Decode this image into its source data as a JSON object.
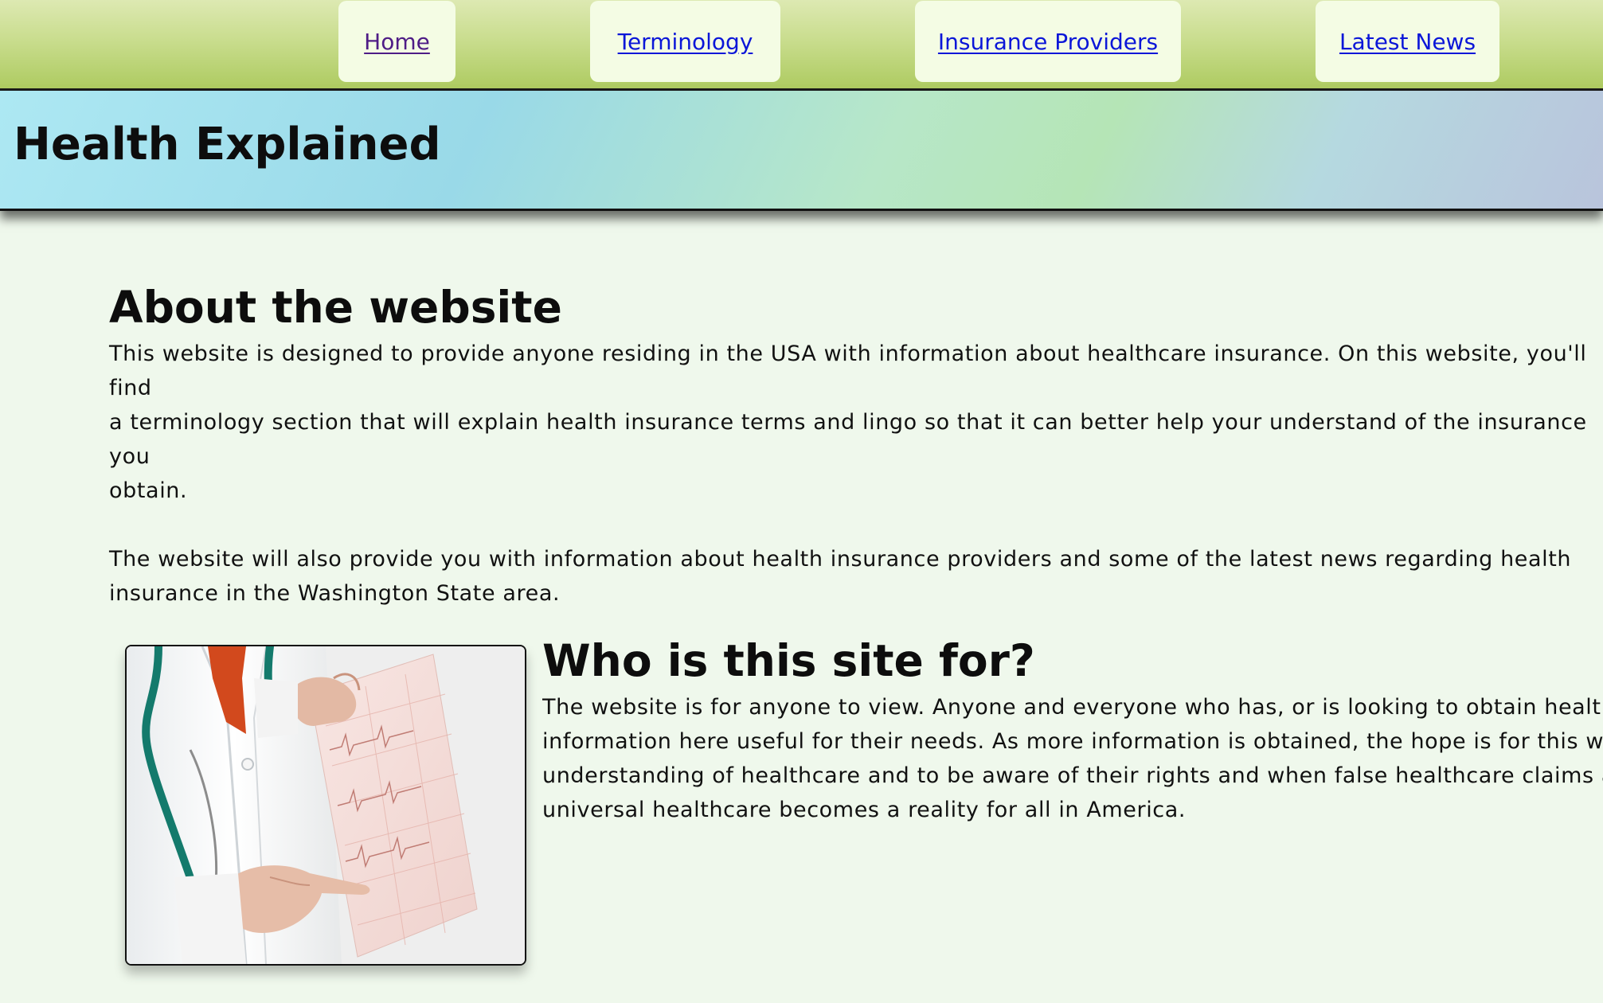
{
  "nav": {
    "items": [
      {
        "label": "Home"
      },
      {
        "label": "Terminology"
      },
      {
        "label": "Insurance Providers"
      },
      {
        "label": "Latest News"
      }
    ]
  },
  "banner": {
    "title": "Health Explained"
  },
  "about": {
    "heading": "About the website",
    "paragraph1_lines": [
      "This website is designed to provide anyone residing in the USA with information about healthcare insurance. On this website, you'll find",
      "a terminology section that will explain health insurance terms and lingo so that it can better help your understand of the insurance you",
      "obtain."
    ],
    "paragraph2_lines": [
      "The website will also provide you with information about health insurance providers and some of the latest news regarding health",
      "insurance in the Washington State area."
    ]
  },
  "who": {
    "heading": "Who is this site for?",
    "paragraph_lines": [
      "The website is for anyone to view. Anyone and everyone who has, or is looking to obtain healthcar",
      "information here useful for their needs. As more information is obtained, the hope is for this webs",
      "understanding of healthcare and to be aware of their rights and when false healthcare claims are r",
      "universal healthcare becomes a reality for all in America."
    ]
  },
  "colors": {
    "nav_link": "#0b16d8",
    "nav_link_visited": "#4e1c86",
    "page_background": "#eff8ec",
    "nav_button_background": "#f4fce4"
  },
  "icons": {
    "photo": "doctor-holding-ecg-chart-image"
  }
}
